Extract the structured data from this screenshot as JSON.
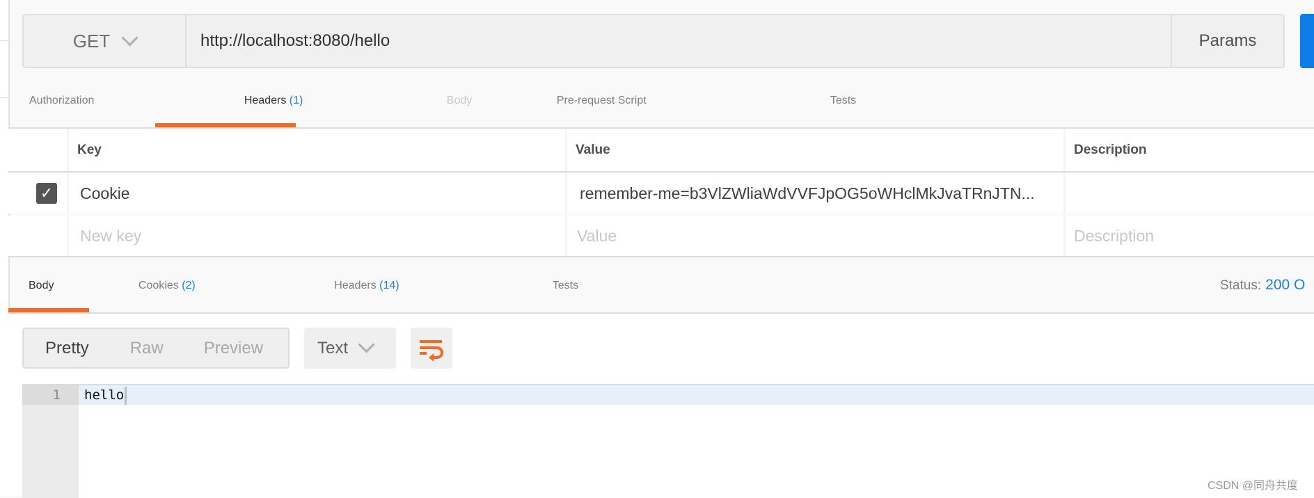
{
  "request": {
    "method": "GET",
    "url": "http://localhost:8080/hello",
    "params_label": "Params",
    "tabs": [
      {
        "label": "Authorization",
        "count": ""
      },
      {
        "label": "Headers",
        "count": "(1)"
      },
      {
        "label": "Body",
        "count": ""
      },
      {
        "label": "Pre-request Script",
        "count": ""
      },
      {
        "label": "Tests",
        "count": ""
      }
    ],
    "active_tab": "Headers"
  },
  "headers_table": {
    "columns": [
      "Key",
      "Value",
      "Description"
    ],
    "rows": [
      {
        "enabled": true,
        "key": "Cookie",
        "value": "remember-me=b3VlZWliaWdVVFJpOG5oWHclMkJvaTRnJTN...",
        "description": ""
      }
    ],
    "placeholders": {
      "key": "New key",
      "value": "Value",
      "description": "Description"
    }
  },
  "response": {
    "tabs": [
      {
        "label": "Body",
        "count": ""
      },
      {
        "label": "Cookies",
        "count": "(2)"
      },
      {
        "label": "Headers",
        "count": "(14)"
      },
      {
        "label": "Tests",
        "count": ""
      }
    ],
    "active_tab": "Body",
    "status_label": "Status:",
    "status_value": "200 O",
    "view_modes": [
      "Pretty",
      "Raw",
      "Preview"
    ],
    "active_view": "Pretty",
    "format": "Text",
    "lines": [
      {
        "number": "1",
        "text": "hello"
      }
    ]
  },
  "watermark": "CSDN @同舟共度",
  "colors": {
    "accent": "#f26b21",
    "link": "#1a81e0",
    "send": "#0f7de8"
  }
}
